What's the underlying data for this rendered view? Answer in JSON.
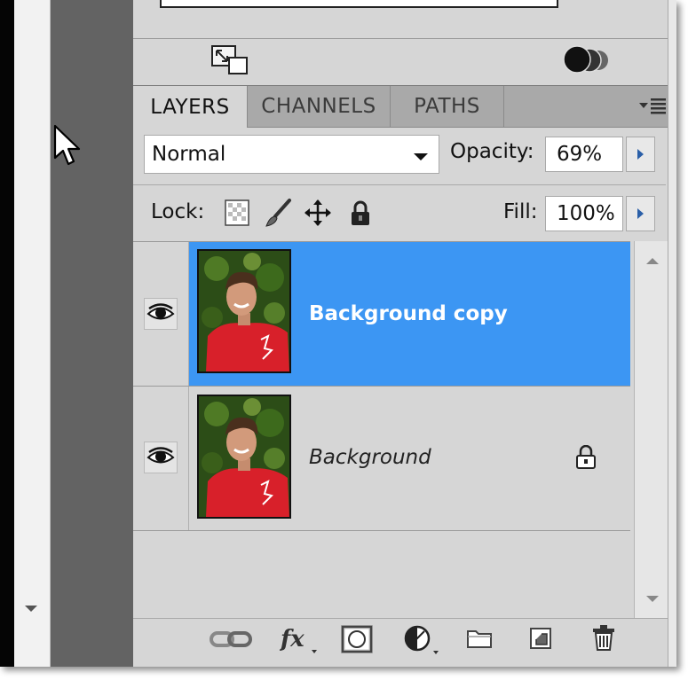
{
  "tabs": [
    {
      "label": "LAYERS",
      "active": true
    },
    {
      "label": "CHANNELS",
      "active": false
    },
    {
      "label": "PATHS",
      "active": false
    }
  ],
  "blend_mode": {
    "value": "Normal"
  },
  "opacity": {
    "label": "Opacity:",
    "value": "69%"
  },
  "lock": {
    "label": "Lock:"
  },
  "fill": {
    "label": "Fill:",
    "value": "100%"
  },
  "layers": [
    {
      "name": "Background copy",
      "selected": true,
      "visible": true,
      "locked": false
    },
    {
      "name": "Background",
      "selected": false,
      "visible": true,
      "locked": true
    }
  ],
  "bottom_icons": [
    "link-icon",
    "fx-icon",
    "mask-icon",
    "adjustment-icon",
    "folder-icon",
    "new-layer-icon",
    "trash-icon"
  ],
  "colors": {
    "selection": "#3c96f3",
    "panel": "#d6d6d6",
    "tab_bar": "#a9a9a9",
    "dark_column": "#636363"
  }
}
